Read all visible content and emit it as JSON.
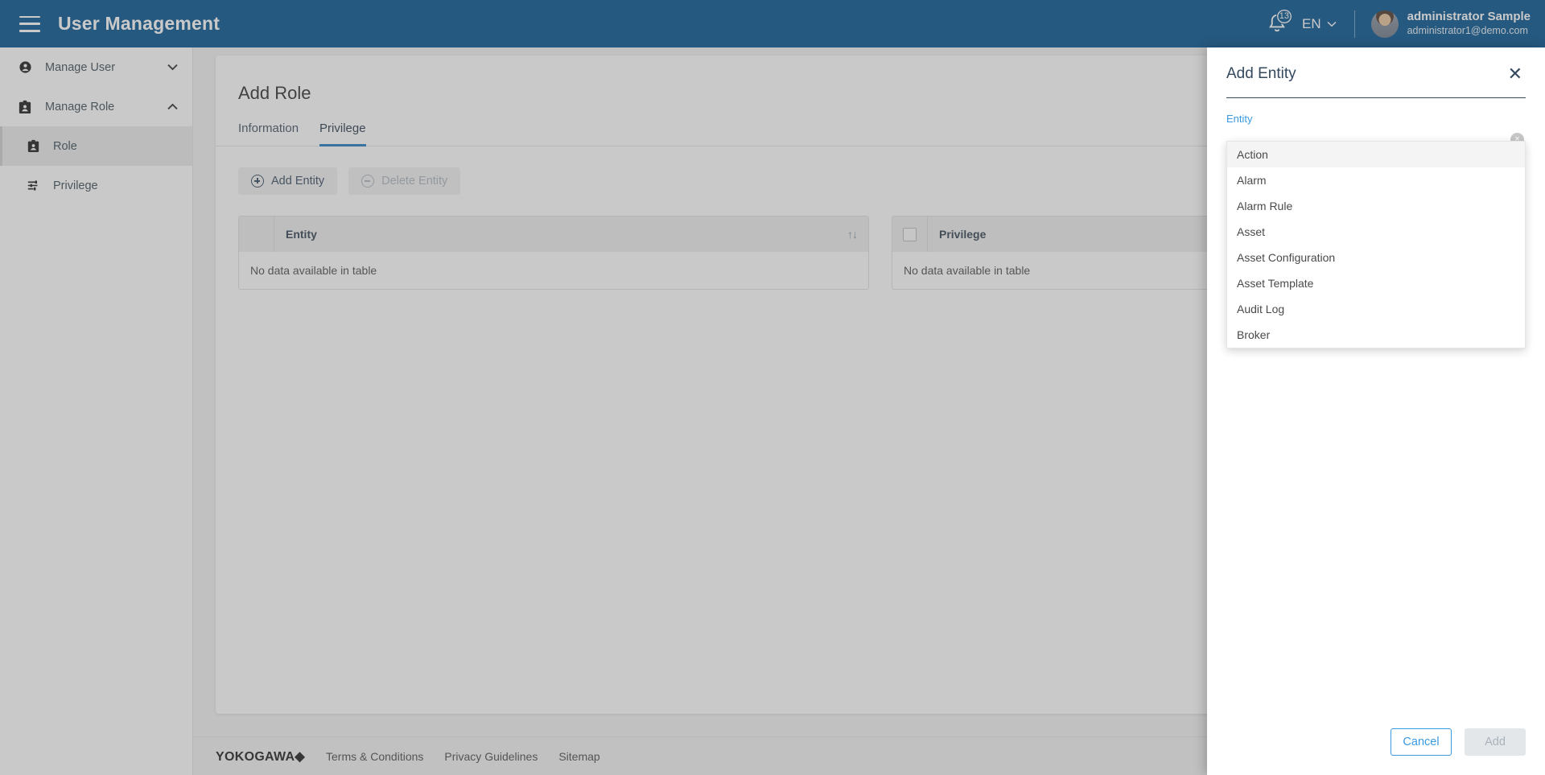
{
  "header": {
    "title": "User Management",
    "menu_icon": "hamburger-icon",
    "notification_count": "13",
    "language": "EN",
    "user_name": "administrator Sample",
    "user_email": "administrator1@demo.com"
  },
  "sidebar": {
    "items": [
      {
        "label": "Manage User",
        "icon": "person-icon",
        "chevron": "⌄",
        "expanded": false
      },
      {
        "label": "Manage Role",
        "icon": "badge-icon",
        "chevron": "⌃",
        "expanded": true
      }
    ],
    "subitems": [
      {
        "label": "Role",
        "icon": "badge-icon",
        "active": true
      },
      {
        "label": "Privilege",
        "icon": "sliders-icon",
        "active": false
      }
    ]
  },
  "main": {
    "page_title": "Add Role",
    "tabs": [
      {
        "label": "Information",
        "active": false
      },
      {
        "label": "Privilege",
        "active": true
      }
    ],
    "buttons": {
      "add_entity": "Add Entity",
      "delete_entity": "Delete Entity"
    },
    "entity_table": {
      "header": "Entity",
      "sort_icon": "↑↓",
      "empty_text": "No data available in table"
    },
    "privilege_table": {
      "header": "Privilege",
      "empty_text": "No data available in table"
    }
  },
  "footer": {
    "brand": "YOKOGAWA◆",
    "links": [
      {
        "label": "Terms & Conditions"
      },
      {
        "label": "Privacy Guidelines"
      },
      {
        "label": "Sitemap"
      }
    ]
  },
  "drawer": {
    "title": "Add Entity",
    "close_icon": "close-icon",
    "field_label": "Entity",
    "field_value": "",
    "field_placeholder": "",
    "clear_icon": "×",
    "options": [
      {
        "label": "Action",
        "highlighted": true
      },
      {
        "label": "Alarm",
        "highlighted": false
      },
      {
        "label": "Alarm Rule",
        "highlighted": false
      },
      {
        "label": "Asset",
        "highlighted": false
      },
      {
        "label": "Asset Configuration",
        "highlighted": false
      },
      {
        "label": "Asset Template",
        "highlighted": false
      },
      {
        "label": "Audit Log",
        "highlighted": false
      },
      {
        "label": "Broker",
        "highlighted": false
      }
    ],
    "cancel_label": "Cancel",
    "add_label": "Add"
  },
  "colors": {
    "brand_blue": "#00508e",
    "accent_blue": "#3a9ae0",
    "tab_underline": "#1f7ac0"
  }
}
